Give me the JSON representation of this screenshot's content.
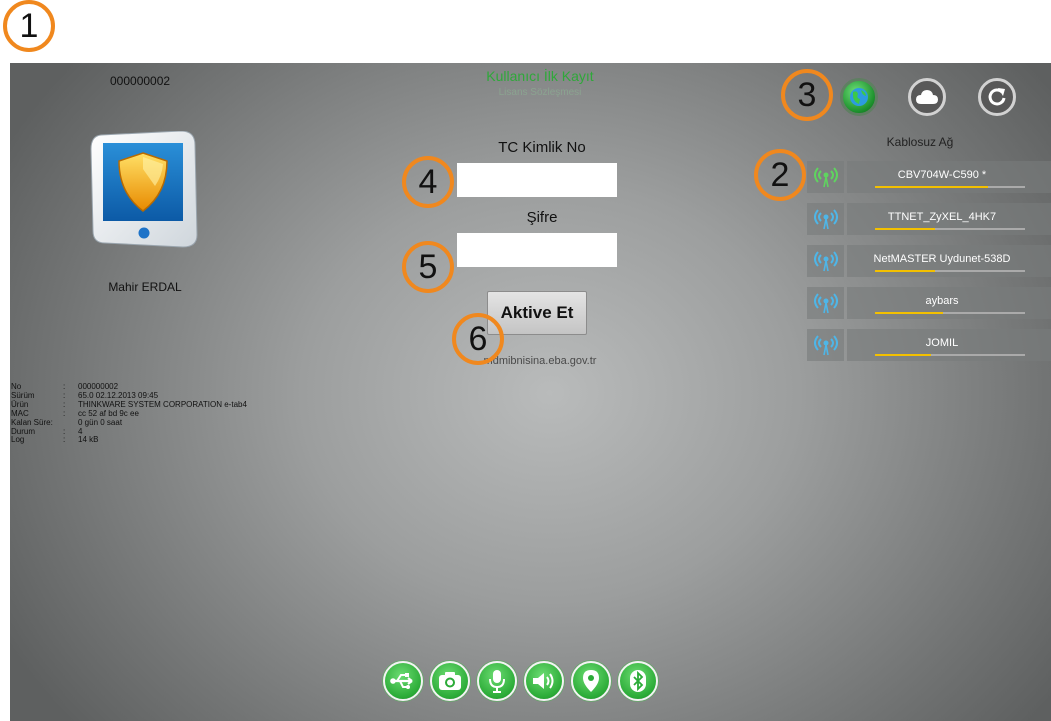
{
  "device_id": "000000002",
  "header": {
    "title": "Kullanıcı İlk Kayıt",
    "subtitle": "Lisans Sözleşmesi"
  },
  "user": {
    "name": "Mahir ERDAL"
  },
  "info": [
    {
      "key": "No",
      "value": "000000002"
    },
    {
      "key": "Sürüm",
      "value": "65.0 02.12.2013 09:45"
    },
    {
      "key": "Ürün",
      "value": "THINKWARE SYSTEM CORPORATION e-tab4"
    },
    {
      "key": "MAC",
      "value": "cc 52 af bd 9c ee"
    },
    {
      "key": "Kalan Süre:",
      "value": "0 gün 0 saat"
    },
    {
      "key": "Durum",
      "value": "4"
    },
    {
      "key": "Log",
      "value": "14 kB"
    }
  ],
  "form": {
    "tc_label": "TC Kimlik No",
    "tc_value": "",
    "password_label": "Şifre",
    "password_value": "",
    "activate_label": "Aktive Et",
    "url": "mdmibnisina.eba.gov.tr"
  },
  "top_buttons": [
    {
      "name": "globe-icon"
    },
    {
      "name": "cloud-icon"
    },
    {
      "name": "refresh-icon"
    }
  ],
  "wifi": {
    "title": "Kablosuz Ağ",
    "networks": [
      {
        "name": "CBV704W-C590 *",
        "signal": 0.75,
        "connected": true
      },
      {
        "name": "TTNET_ZyXEL_4HK7",
        "signal": 0.4,
        "connected": false
      },
      {
        "name": "NetMASTER Uydunet-538D",
        "signal": 0.4,
        "connected": false
      },
      {
        "name": "aybars",
        "signal": 0.45,
        "connected": false
      },
      {
        "name": "JOMIL",
        "signal": 0.37,
        "connected": false
      }
    ]
  },
  "bottom_buttons": [
    "usb-icon",
    "camera-icon",
    "microphone-icon",
    "speaker-icon",
    "location-icon",
    "bluetooth-icon"
  ],
  "callouts": [
    "1",
    "2",
    "3",
    "4",
    "5",
    "6"
  ],
  "colors": {
    "accent": "#2fa83a",
    "callout": "#f0881e",
    "signal": "#f3c000",
    "wifi_connected": "#5fd45f",
    "wifi_idle": "#4eb6e8"
  }
}
